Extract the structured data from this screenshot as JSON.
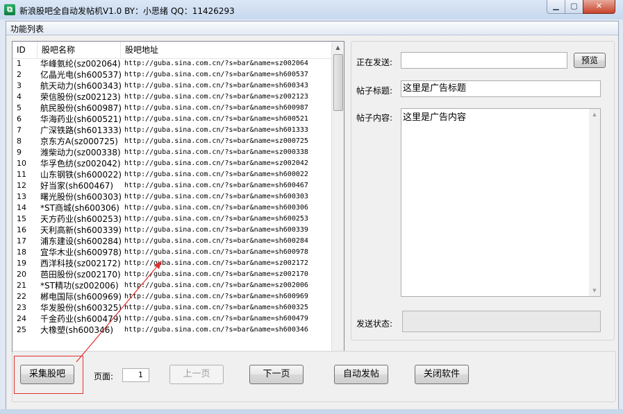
{
  "window": {
    "title": "新浪股吧全自动发帖机V1.0  BY：小思绪   QQ：11426293",
    "app_icon": "shopping-bag-icon",
    "controls": {
      "minimize": "▁",
      "maximize": "▢",
      "close": "✕"
    }
  },
  "menu": {
    "items": [
      "功能列表"
    ]
  },
  "list": {
    "columns": [
      "ID",
      "股吧名称",
      "股吧地址"
    ],
    "rows": [
      [
        "1",
        "华峰氨纶(sz002064)",
        "http://guba.sina.com.cn/?s=bar&name=sz002064"
      ],
      [
        "2",
        "亿晶光电(sh600537)",
        "http://guba.sina.com.cn/?s=bar&name=sh600537"
      ],
      [
        "3",
        "航天动力(sh600343)",
        "http://guba.sina.com.cn/?s=bar&name=sh600343"
      ],
      [
        "4",
        "荣信股份(sz002123)",
        "http://guba.sina.com.cn/?s=bar&name=sz002123"
      ],
      [
        "5",
        "航民股份(sh600987)",
        "http://guba.sina.com.cn/?s=bar&name=sh600987"
      ],
      [
        "6",
        "华海药业(sh600521)",
        "http://guba.sina.com.cn/?s=bar&name=sh600521"
      ],
      [
        "7",
        "广深铁路(sh601333)",
        "http://guba.sina.com.cn/?s=bar&name=sh601333"
      ],
      [
        "8",
        "京东方A(sz000725)",
        "http://guba.sina.com.cn/?s=bar&name=sz000725"
      ],
      [
        "9",
        "潍柴动力(sz000338)",
        "http://guba.sina.com.cn/?s=bar&name=sz000338"
      ],
      [
        "10",
        "华孚色纺(sz002042)",
        "http://guba.sina.com.cn/?s=bar&name=sz002042"
      ],
      [
        "11",
        "山东钢铁(sh600022)",
        "http://guba.sina.com.cn/?s=bar&name=sh600022"
      ],
      [
        "12",
        "好当家(sh600467)",
        "http://guba.sina.com.cn/?s=bar&name=sh600467"
      ],
      [
        "13",
        "曙光股份(sh600303)",
        "http://guba.sina.com.cn/?s=bar&name=sh600303"
      ],
      [
        "14",
        "*ST商城(sh600306)",
        "http://guba.sina.com.cn/?s=bar&name=sh600306"
      ],
      [
        "15",
        "天方药业(sh600253)",
        "http://guba.sina.com.cn/?s=bar&name=sh600253"
      ],
      [
        "16",
        "天利高新(sh600339)",
        "http://guba.sina.com.cn/?s=bar&name=sh600339"
      ],
      [
        "17",
        "浦东建设(sh600284)",
        "http://guba.sina.com.cn/?s=bar&name=sh600284"
      ],
      [
        "18",
        "宜华木业(sh600978)",
        "http://guba.sina.com.cn/?s=bar&name=sh600978"
      ],
      [
        "19",
        "西洋科技(sz002172)",
        "http://guba.sina.com.cn/?s=bar&name=sz002172"
      ],
      [
        "20",
        "芭田股份(sz002170)",
        "http://guba.sina.com.cn/?s=bar&name=sz002170"
      ],
      [
        "21",
        "*ST精功(sz002006)",
        "http://guba.sina.com.cn/?s=bar&name=sz002006"
      ],
      [
        "22",
        "郴电国际(sh600969)",
        "http://guba.sina.com.cn/?s=bar&name=sh600969"
      ],
      [
        "23",
        "华发股份(sh600325)",
        "http://guba.sina.com.cn/?s=bar&name=sh600325"
      ],
      [
        "24",
        "千金药业(sh600479)",
        "http://guba.sina.com.cn/?s=bar&name=sh600479"
      ],
      [
        "25",
        "大橡塑(sh600346)",
        "http://guba.sina.com.cn/?s=bar&name=sh600346"
      ]
    ]
  },
  "form": {
    "sending_label": "正在发送:",
    "sending_value": "",
    "preview_button": "预览",
    "title_label": "帖子标题:",
    "title_value": "这里是广告标题",
    "content_label": "帖子内容:",
    "content_value": "这里是广告内容",
    "status_label": "发送状态:"
  },
  "toolbar": {
    "collect_button": "采集股吧",
    "page_label": "页面:",
    "page_value": "1",
    "prev_button": "上一页",
    "next_button": "下一页",
    "auto_post_button": "自动发帖",
    "close_button": "关闭软件"
  },
  "colors": {
    "annotation": "#e03030",
    "title_gradient": "#c7d8ee"
  }
}
